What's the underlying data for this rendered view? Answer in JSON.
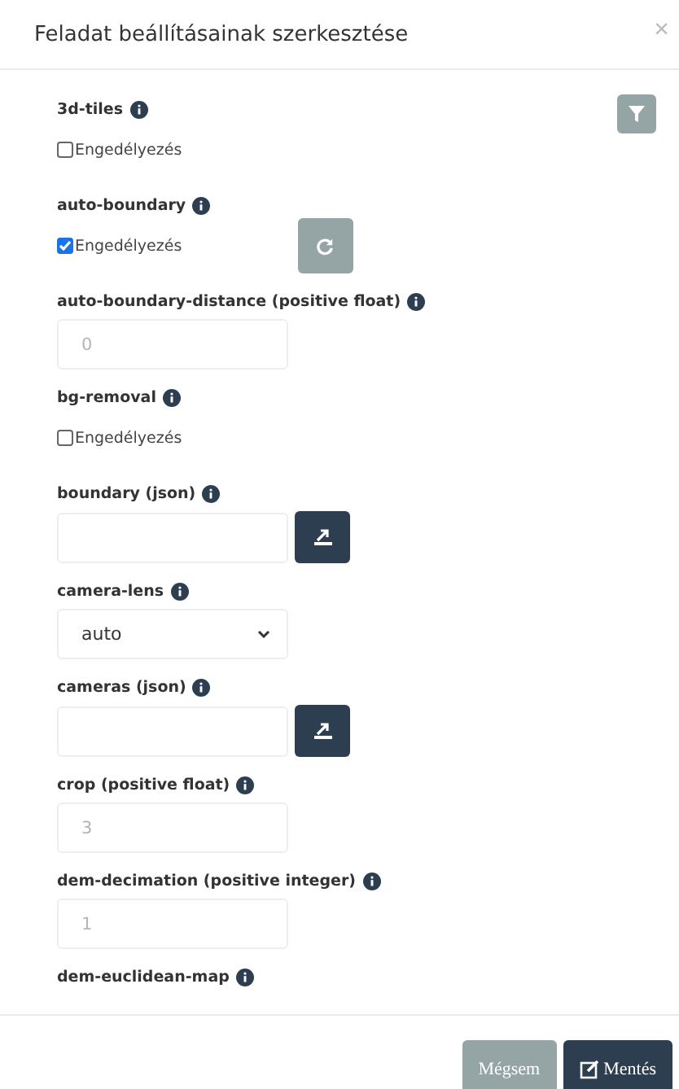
{
  "dialog": {
    "title": "Feladat beállításainak szerkesztése",
    "close": "×"
  },
  "fields": [
    {
      "kind": "checkbox",
      "label": "3d-tiles",
      "option": "Engedélyezés",
      "checked": false
    },
    {
      "kind": "checkbox",
      "label": "auto-boundary",
      "option": "Engedélyezés",
      "checked": true,
      "reset": true
    },
    {
      "kind": "text",
      "label": "auto-boundary-distance (positive float)",
      "placeholder": "0"
    },
    {
      "kind": "checkbox",
      "label": "bg-removal",
      "option": "Engedélyezés",
      "checked": false
    },
    {
      "kind": "json",
      "label": "boundary (json)"
    },
    {
      "kind": "select",
      "label": "camera-lens",
      "value": "auto"
    },
    {
      "kind": "json",
      "label": "cameras (json)"
    },
    {
      "kind": "text",
      "label": "crop (positive float)",
      "placeholder": "3"
    },
    {
      "kind": "text",
      "label": "dem-decimation (positive integer)",
      "placeholder": "1"
    },
    {
      "kind": "heading",
      "label": "dem-euclidean-map"
    }
  ],
  "buttons": [
    {
      "label": "Mégsem",
      "kind": "cancel"
    },
    {
      "label": "Mentés",
      "kind": "save"
    }
  ]
}
